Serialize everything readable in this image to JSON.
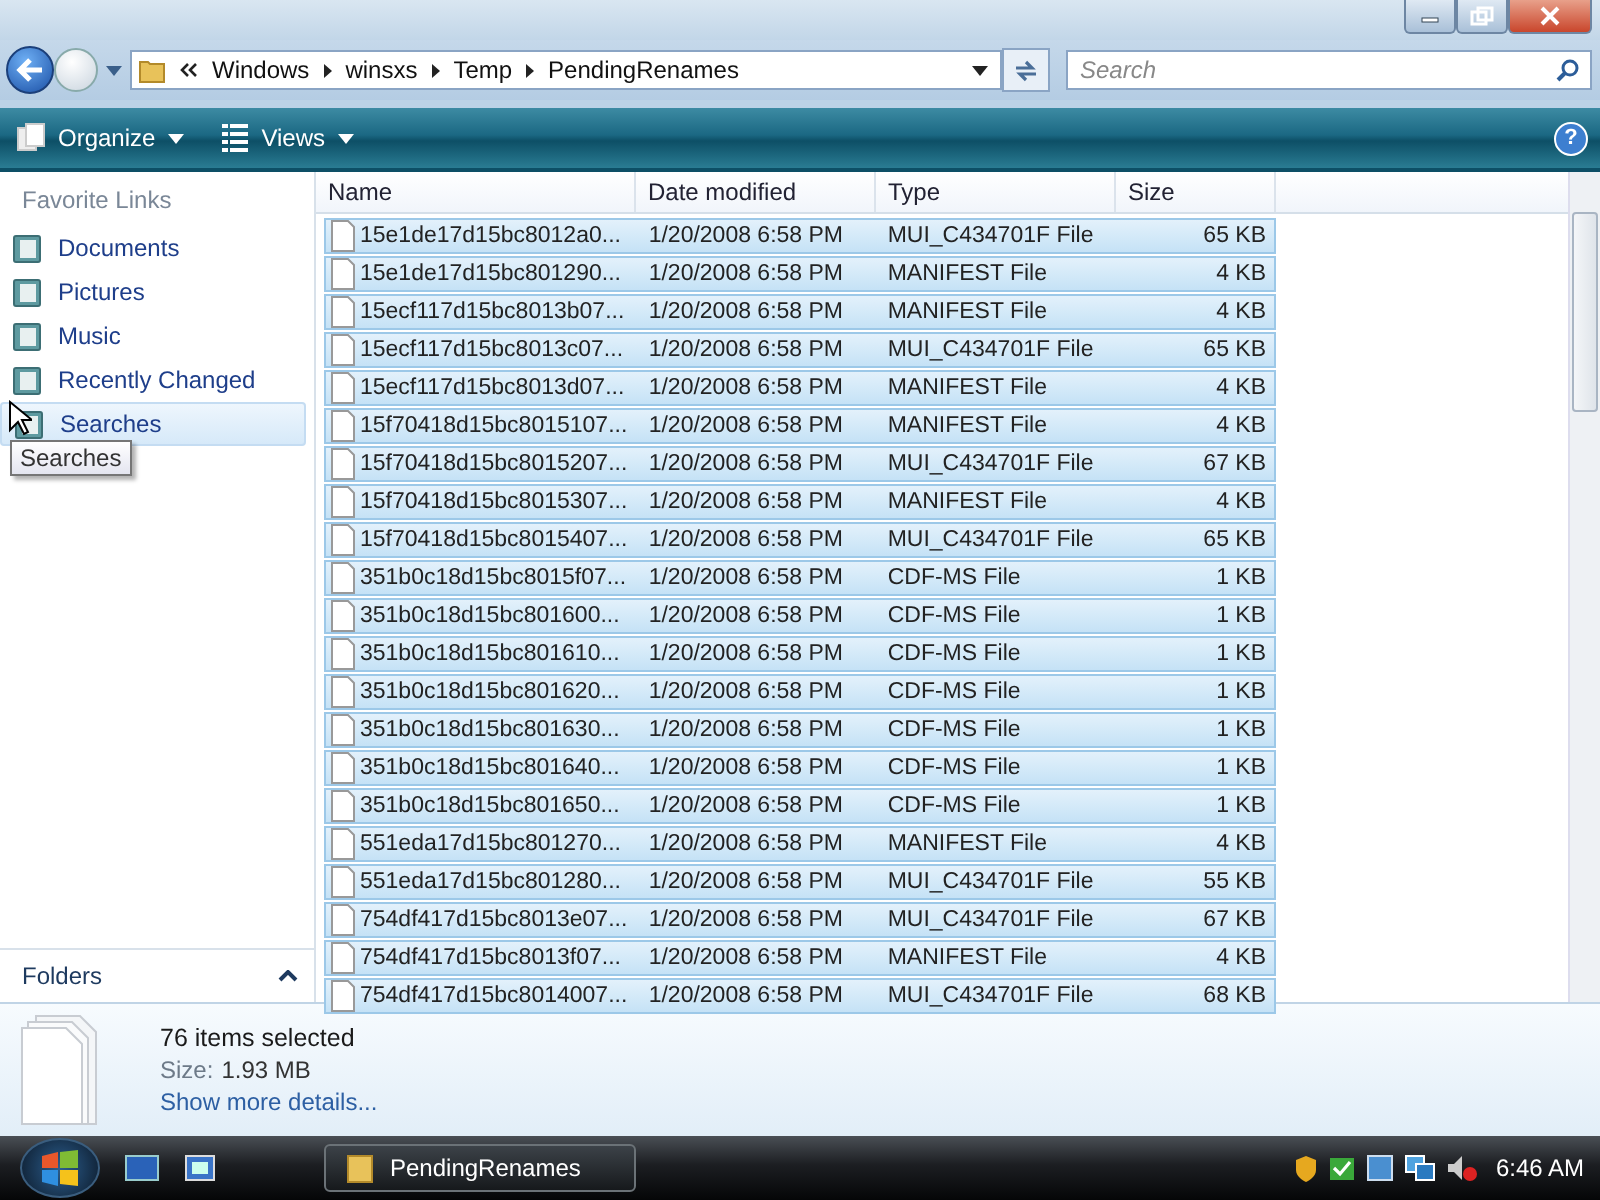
{
  "address": {
    "path": [
      "Windows",
      "winsxs",
      "Temp",
      "PendingRenames"
    ]
  },
  "search": {
    "placeholder": "Search"
  },
  "toolbar": {
    "buttons": [
      {
        "label": "Organize"
      },
      {
        "label": "Views"
      }
    ],
    "help": "?"
  },
  "sidebar": {
    "heading": "Favorite Links",
    "items": [
      {
        "label": "Documents",
        "selected": false
      },
      {
        "label": "Pictures",
        "selected": false
      },
      {
        "label": "Music",
        "selected": false
      },
      {
        "label": "Recently Changed",
        "selected": false
      },
      {
        "label": "Searches",
        "selected": true
      }
    ],
    "tooltip": "Searches",
    "folders": "Folders"
  },
  "table": {
    "columns": [
      "Name",
      "Date modified",
      "Type",
      "Size"
    ],
    "rows": [
      {
        "name": "15e1de17d15bc8012a0...",
        "date": "1/20/2008 6:58 PM",
        "type": "MUI_C434701F File",
        "size": "65 KB",
        "selected": true
      },
      {
        "name": "15e1de17d15bc801290...",
        "date": "1/20/2008 6:58 PM",
        "type": "MANIFEST File",
        "size": "4 KB",
        "selected": true
      },
      {
        "name": "15ecf117d15bc8013b07...",
        "date": "1/20/2008 6:58 PM",
        "type": "MANIFEST File",
        "size": "4 KB",
        "selected": true
      },
      {
        "name": "15ecf117d15bc8013c07...",
        "date": "1/20/2008 6:58 PM",
        "type": "MUI_C434701F File",
        "size": "65 KB",
        "selected": true
      },
      {
        "name": "15ecf117d15bc8013d07...",
        "date": "1/20/2008 6:58 PM",
        "type": "MANIFEST File",
        "size": "4 KB",
        "selected": true
      },
      {
        "name": "15f70418d15bc8015107...",
        "date": "1/20/2008 6:58 PM",
        "type": "MANIFEST File",
        "size": "4 KB",
        "selected": true
      },
      {
        "name": "15f70418d15bc8015207...",
        "date": "1/20/2008 6:58 PM",
        "type": "MUI_C434701F File",
        "size": "67 KB",
        "selected": true
      },
      {
        "name": "15f70418d15bc8015307...",
        "date": "1/20/2008 6:58 PM",
        "type": "MANIFEST File",
        "size": "4 KB",
        "selected": true
      },
      {
        "name": "15f70418d15bc8015407...",
        "date": "1/20/2008 6:58 PM",
        "type": "MUI_C434701F File",
        "size": "65 KB",
        "selected": true
      },
      {
        "name": "351b0c18d15bc8015f07...",
        "date": "1/20/2008 6:58 PM",
        "type": "CDF-MS File",
        "size": "1 KB",
        "selected": true
      },
      {
        "name": "351b0c18d15bc801600...",
        "date": "1/20/2008 6:58 PM",
        "type": "CDF-MS File",
        "size": "1 KB",
        "selected": true
      },
      {
        "name": "351b0c18d15bc801610...",
        "date": "1/20/2008 6:58 PM",
        "type": "CDF-MS File",
        "size": "1 KB",
        "selected": true
      },
      {
        "name": "351b0c18d15bc801620...",
        "date": "1/20/2008 6:58 PM",
        "type": "CDF-MS File",
        "size": "1 KB",
        "selected": true
      },
      {
        "name": "351b0c18d15bc801630...",
        "date": "1/20/2008 6:58 PM",
        "type": "CDF-MS File",
        "size": "1 KB",
        "selected": true
      },
      {
        "name": "351b0c18d15bc801640...",
        "date": "1/20/2008 6:58 PM",
        "type": "CDF-MS File",
        "size": "1 KB",
        "selected": true
      },
      {
        "name": "351b0c18d15bc801650...",
        "date": "1/20/2008 6:58 PM",
        "type": "CDF-MS File",
        "size": "1 KB",
        "selected": true
      },
      {
        "name": "551eda17d15bc801270...",
        "date": "1/20/2008 6:58 PM",
        "type": "MANIFEST File",
        "size": "4 KB",
        "selected": true
      },
      {
        "name": "551eda17d15bc801280...",
        "date": "1/20/2008 6:58 PM",
        "type": "MUI_C434701F File",
        "size": "55 KB",
        "selected": true
      },
      {
        "name": "754df417d15bc8013e07...",
        "date": "1/20/2008 6:58 PM",
        "type": "MUI_C434701F File",
        "size": "67 KB",
        "selected": true
      },
      {
        "name": "754df417d15bc8013f07...",
        "date": "1/20/2008 6:58 PM",
        "type": "MANIFEST File",
        "size": "4 KB",
        "selected": true
      },
      {
        "name": "754df417d15bc8014007...",
        "date": "1/20/2008 6:58 PM",
        "type": "MUI_C434701F File",
        "size": "68 KB",
        "selected": true
      }
    ]
  },
  "details": {
    "title": "76 items selected",
    "size_label": "Size:",
    "size_value": "1.93 MB",
    "link": "Show more details..."
  },
  "taskbar": {
    "task": "PendingRenames",
    "clock": "6:46 AM"
  }
}
